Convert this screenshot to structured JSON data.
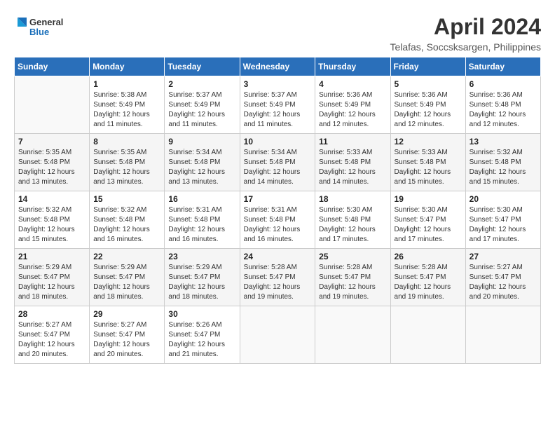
{
  "logo": {
    "general": "General",
    "blue": "Blue"
  },
  "title": "April 2024",
  "subtitle": "Telafas, Soccsksargen, Philippines",
  "days_header": [
    "Sunday",
    "Monday",
    "Tuesday",
    "Wednesday",
    "Thursday",
    "Friday",
    "Saturday"
  ],
  "weeks": [
    [
      {
        "day": "",
        "info": ""
      },
      {
        "day": "1",
        "info": "Sunrise: 5:38 AM\nSunset: 5:49 PM\nDaylight: 12 hours\nand 11 minutes."
      },
      {
        "day": "2",
        "info": "Sunrise: 5:37 AM\nSunset: 5:49 PM\nDaylight: 12 hours\nand 11 minutes."
      },
      {
        "day": "3",
        "info": "Sunrise: 5:37 AM\nSunset: 5:49 PM\nDaylight: 12 hours\nand 11 minutes."
      },
      {
        "day": "4",
        "info": "Sunrise: 5:36 AM\nSunset: 5:49 PM\nDaylight: 12 hours\nand 12 minutes."
      },
      {
        "day": "5",
        "info": "Sunrise: 5:36 AM\nSunset: 5:49 PM\nDaylight: 12 hours\nand 12 minutes."
      },
      {
        "day": "6",
        "info": "Sunrise: 5:36 AM\nSunset: 5:48 PM\nDaylight: 12 hours\nand 12 minutes."
      }
    ],
    [
      {
        "day": "7",
        "info": "Sunrise: 5:35 AM\nSunset: 5:48 PM\nDaylight: 12 hours\nand 13 minutes."
      },
      {
        "day": "8",
        "info": "Sunrise: 5:35 AM\nSunset: 5:48 PM\nDaylight: 12 hours\nand 13 minutes."
      },
      {
        "day": "9",
        "info": "Sunrise: 5:34 AM\nSunset: 5:48 PM\nDaylight: 12 hours\nand 13 minutes."
      },
      {
        "day": "10",
        "info": "Sunrise: 5:34 AM\nSunset: 5:48 PM\nDaylight: 12 hours\nand 14 minutes."
      },
      {
        "day": "11",
        "info": "Sunrise: 5:33 AM\nSunset: 5:48 PM\nDaylight: 12 hours\nand 14 minutes."
      },
      {
        "day": "12",
        "info": "Sunrise: 5:33 AM\nSunset: 5:48 PM\nDaylight: 12 hours\nand 15 minutes."
      },
      {
        "day": "13",
        "info": "Sunrise: 5:32 AM\nSunset: 5:48 PM\nDaylight: 12 hours\nand 15 minutes."
      }
    ],
    [
      {
        "day": "14",
        "info": "Sunrise: 5:32 AM\nSunset: 5:48 PM\nDaylight: 12 hours\nand 15 minutes."
      },
      {
        "day": "15",
        "info": "Sunrise: 5:32 AM\nSunset: 5:48 PM\nDaylight: 12 hours\nand 16 minutes."
      },
      {
        "day": "16",
        "info": "Sunrise: 5:31 AM\nSunset: 5:48 PM\nDaylight: 12 hours\nand 16 minutes."
      },
      {
        "day": "17",
        "info": "Sunrise: 5:31 AM\nSunset: 5:48 PM\nDaylight: 12 hours\nand 16 minutes."
      },
      {
        "day": "18",
        "info": "Sunrise: 5:30 AM\nSunset: 5:48 PM\nDaylight: 12 hours\nand 17 minutes."
      },
      {
        "day": "19",
        "info": "Sunrise: 5:30 AM\nSunset: 5:47 PM\nDaylight: 12 hours\nand 17 minutes."
      },
      {
        "day": "20",
        "info": "Sunrise: 5:30 AM\nSunset: 5:47 PM\nDaylight: 12 hours\nand 17 minutes."
      }
    ],
    [
      {
        "day": "21",
        "info": "Sunrise: 5:29 AM\nSunset: 5:47 PM\nDaylight: 12 hours\nand 18 minutes."
      },
      {
        "day": "22",
        "info": "Sunrise: 5:29 AM\nSunset: 5:47 PM\nDaylight: 12 hours\nand 18 minutes."
      },
      {
        "day": "23",
        "info": "Sunrise: 5:29 AM\nSunset: 5:47 PM\nDaylight: 12 hours\nand 18 minutes."
      },
      {
        "day": "24",
        "info": "Sunrise: 5:28 AM\nSunset: 5:47 PM\nDaylight: 12 hours\nand 19 minutes."
      },
      {
        "day": "25",
        "info": "Sunrise: 5:28 AM\nSunset: 5:47 PM\nDaylight: 12 hours\nand 19 minutes."
      },
      {
        "day": "26",
        "info": "Sunrise: 5:28 AM\nSunset: 5:47 PM\nDaylight: 12 hours\nand 19 minutes."
      },
      {
        "day": "27",
        "info": "Sunrise: 5:27 AM\nSunset: 5:47 PM\nDaylight: 12 hours\nand 20 minutes."
      }
    ],
    [
      {
        "day": "28",
        "info": "Sunrise: 5:27 AM\nSunset: 5:47 PM\nDaylight: 12 hours\nand 20 minutes."
      },
      {
        "day": "29",
        "info": "Sunrise: 5:27 AM\nSunset: 5:47 PM\nDaylight: 12 hours\nand 20 minutes."
      },
      {
        "day": "30",
        "info": "Sunrise: 5:26 AM\nSunset: 5:47 PM\nDaylight: 12 hours\nand 21 minutes."
      },
      {
        "day": "",
        "info": ""
      },
      {
        "day": "",
        "info": ""
      },
      {
        "day": "",
        "info": ""
      },
      {
        "day": "",
        "info": ""
      }
    ]
  ]
}
